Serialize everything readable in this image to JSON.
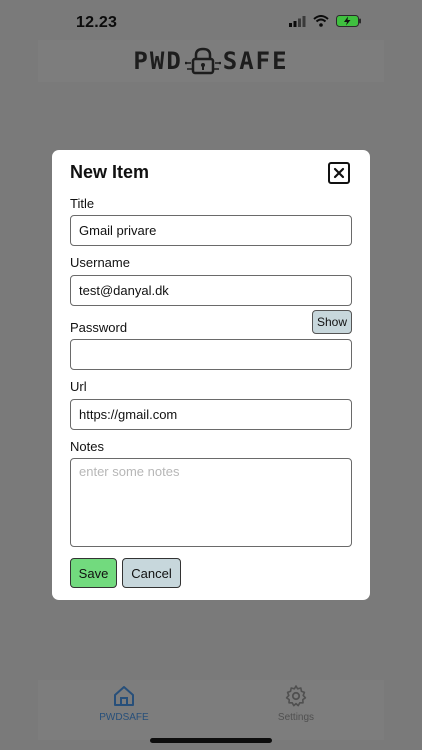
{
  "status_bar": {
    "time": "12.23"
  },
  "header": {
    "logo_left": "PWD",
    "logo_right": "SAFE"
  },
  "modal": {
    "title": "New Item",
    "fields": {
      "title": {
        "label": "Title",
        "value": "Gmail privare",
        "placeholder": ""
      },
      "username": {
        "label": "Username",
        "value": "test@danyal.dk",
        "placeholder": ""
      },
      "password": {
        "label": "Password",
        "value": "",
        "placeholder": "",
        "show_label": "Show"
      },
      "url": {
        "label": "Url",
        "value": "https://gmail.com",
        "placeholder": ""
      },
      "notes": {
        "label": "Notes",
        "value": "",
        "placeholder": "enter some notes"
      }
    },
    "buttons": {
      "save": "Save",
      "cancel": "Cancel"
    }
  },
  "tabbar": {
    "items": [
      {
        "label": "PWDSAFE",
        "icon": "home-icon",
        "active": true
      },
      {
        "label": "Settings",
        "icon": "gear-icon",
        "active": false
      }
    ]
  },
  "colors": {
    "save_button": "#72da7e",
    "secondary_button": "#c7d7dc",
    "active_tab": "#274f7a",
    "overlay": "#7a7a7a"
  }
}
